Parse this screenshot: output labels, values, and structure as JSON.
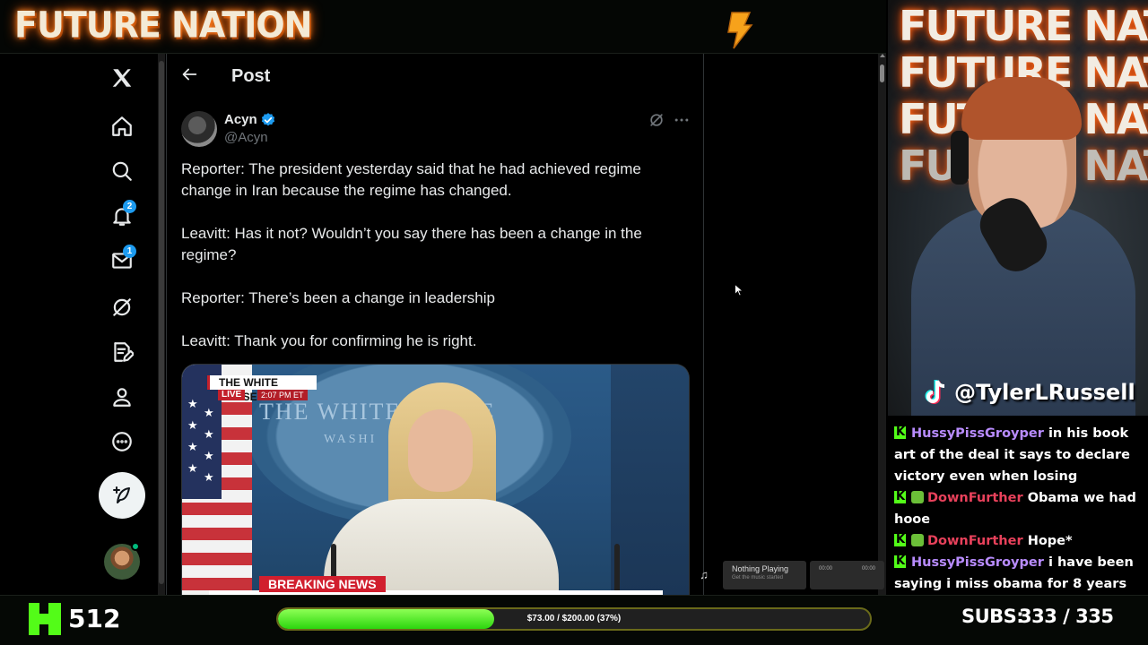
{
  "overlay": {
    "brand": "FUTURE NATION",
    "cam_texts": [
      "FUTURE NATION",
      "FUTURE NATION",
      "FUTURE NATION",
      "FUTURE NATION"
    ],
    "tiktok_handle": "@TylerLRussell",
    "viewer_count": "512",
    "goal": {
      "text": "$73.00 / $200.00 (37%)",
      "fraction": 0.365
    },
    "subs_label": "SUBS:",
    "subs_value": "333 / 335",
    "accent_color": "#53fc18"
  },
  "x_sidebar": {
    "items": [
      {
        "icon": "x-logo-icon"
      },
      {
        "icon": "home-icon"
      },
      {
        "icon": "search-icon"
      },
      {
        "icon": "bell-icon",
        "badge": "2"
      },
      {
        "icon": "mail-icon",
        "badge": "1"
      },
      {
        "icon": "grok-icon"
      },
      {
        "icon": "edit-list-icon"
      },
      {
        "icon": "profile-icon"
      },
      {
        "icon": "more-circle-icon"
      }
    ]
  },
  "post": {
    "header_title": "Post",
    "author_name": "Acyn",
    "author_handle": "@Acyn",
    "paragraphs": [
      "Reporter: The president yesterday said that he had achieved regime change in Iran because the regime has changed.",
      "Leavitt: Has it not? Wouldn’t you say there has been a change in the regime?",
      "Reporter: There’s been a change in leadership",
      "Leavitt: Thank you for confirming he is right."
    ],
    "media": {
      "chyron_title": "THE WHITE HOUSE",
      "chyron_live": "LIVE",
      "chyron_time": "2:07 PM ET",
      "seal_text": "THE WHITE HOUSE",
      "seal_sub": "WASHI",
      "banner": "BREAKING NEWS"
    }
  },
  "player": {
    "title": "Nothing Playing",
    "subtitle": "Get the music started",
    "time_left": "00:00",
    "time_right": "00:00"
  },
  "chat": {
    "messages": [
      {
        "user": "HussyPissGroyper",
        "text": "in his book art of the deal it says to declare victory even when losing",
        "color": "purple",
        "badge": false
      },
      {
        "user": "DownFurther",
        "text": "Obama we had hooe",
        "color": "red",
        "badge": true
      },
      {
        "user": "DownFurther",
        "text": "Hope*",
        "color": "red",
        "badge": true
      },
      {
        "user": "HussyPissGroyper",
        "text": "i have been saying i miss obama for 8 years",
        "color": "purple",
        "badge": false
      }
    ]
  }
}
